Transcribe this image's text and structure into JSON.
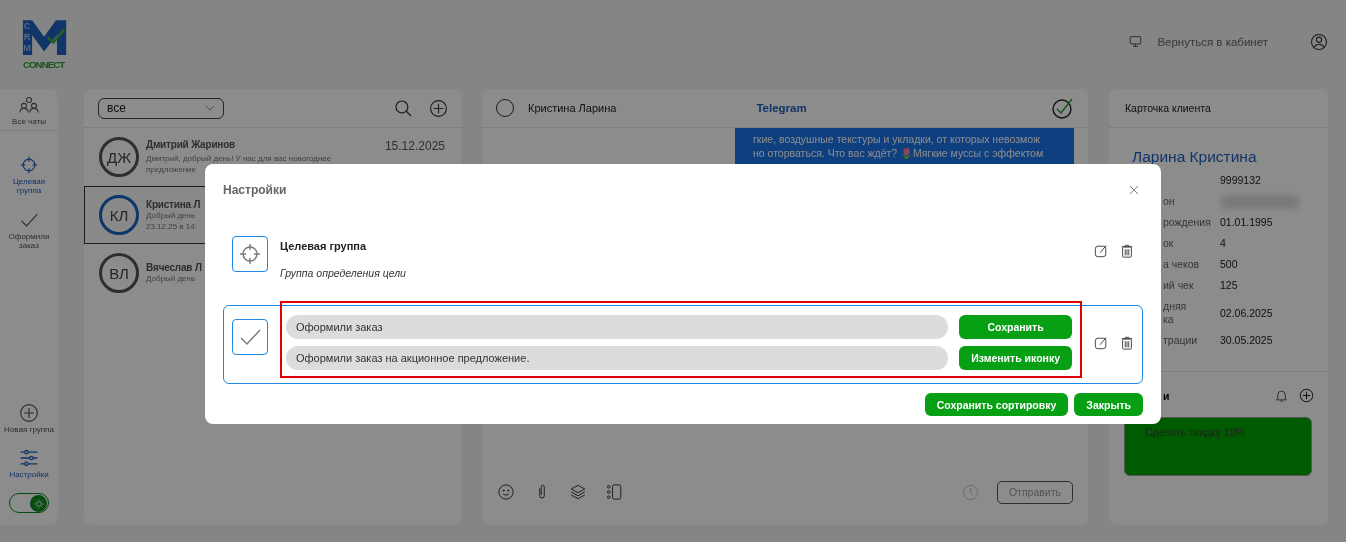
{
  "logo": {
    "letters": [
      "C",
      "R",
      "M"
    ],
    "word": "CONNECT"
  },
  "header": {
    "back_link": "Вернуться в кабинет"
  },
  "nav": {
    "items": [
      {
        "label": "Все чаты",
        "selected": false
      },
      {
        "label": "Целевая группа",
        "selected": true
      },
      {
        "label": "Оформили заказ",
        "selected": false
      }
    ],
    "bottom": [
      {
        "label": "Новая группа",
        "selected": false
      },
      {
        "label": "Настройки",
        "selected": true
      }
    ],
    "theme_toggle": {
      "on": true
    }
  },
  "chat_list": {
    "filter": "все",
    "chats": [
      {
        "initials": "ДЖ",
        "name": "Дмитрий Жаринов",
        "date": "15.12.2025",
        "preview": [
          "Дмитрий, добрый день! У нас для вас новогоднее",
          "предложение"
        ],
        "selected": false
      },
      {
        "initials": "КЛ",
        "name": "Кристина Л",
        "preview": [
          "Добрый день",
          "23.12.25 в 14:"
        ],
        "selected": true
      },
      {
        "initials": "ВЛ",
        "name": "Вячеслав Л",
        "preview": [
          "Добрый день"
        ],
        "selected": false
      }
    ]
  },
  "chat": {
    "contact": "Кристина Ларина",
    "channel": "Telegram",
    "message_lines": [
      "гкие, воздушные текстуры и укладки, от которых невозмож",
      "но оторваться. Что вас ждёт? 🌷Мягкие муссы с эффектом"
    ],
    "send": "Отправить"
  },
  "client_card": {
    "title": "Карточка клиента",
    "name": "Ларина Кристина",
    "fields": [
      {
        "kind": "text",
        "value": "9999132"
      },
      {
        "kind": "blurred",
        "label": "он"
      },
      {
        "kind": "text",
        "label": "рождения",
        "value": "01.01.1995"
      },
      {
        "kind": "text",
        "label": "ок",
        "value": "4"
      },
      {
        "kind": "text",
        "label": "а чеков",
        "value": "500"
      },
      {
        "kind": "text",
        "label": "ий чек",
        "value": "125"
      },
      {
        "kind": "text",
        "label": "дняя\nка",
        "value": "02.06.2025"
      },
      {
        "kind": "text",
        "label": "трации",
        "value": "30.05.2025"
      }
    ],
    "notes_title": "и",
    "notes": [
      {
        "text": "Сделать скидку 10%",
        "color": "#005a00"
      }
    ]
  },
  "modal": {
    "title": "Настройки",
    "groups": [
      {
        "title": "Целевая группа",
        "description": "Группа определения цели",
        "editing": false
      },
      {
        "title": "Оформили заказ",
        "description": "Оформили заказ на акционное предложение.",
        "editing": true,
        "save": "Сохранить",
        "change_icon": "Изменить иконку"
      }
    ],
    "save_order": "Сохранить сортировку",
    "close": "Закрыть"
  }
}
